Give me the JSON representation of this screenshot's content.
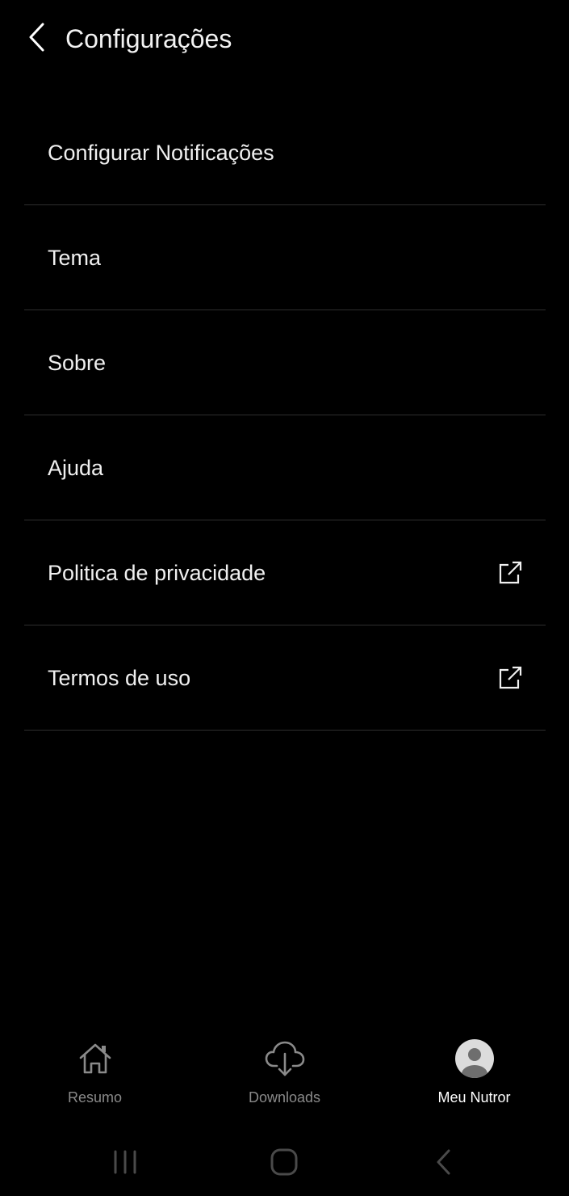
{
  "header": {
    "back_icon": "chevron-left-icon",
    "title": "Configurações"
  },
  "menu": {
    "items": [
      {
        "label": "Configurar Notificações",
        "external": false
      },
      {
        "label": "Tema",
        "external": false
      },
      {
        "label": "Sobre",
        "external": false
      },
      {
        "label": "Ajuda",
        "external": false
      },
      {
        "label": "Politica de privacidade",
        "external": true,
        "icon": "external-link-icon"
      },
      {
        "label": "Termos de uso",
        "external": true,
        "icon": "external-link-icon"
      }
    ]
  },
  "bottom_nav": {
    "items": [
      {
        "label": "Resumo",
        "icon": "home-icon",
        "active": false
      },
      {
        "label": "Downloads",
        "icon": "cloud-download-icon",
        "active": false
      },
      {
        "label": "Meu Nutror",
        "icon": "avatar-icon",
        "active": true
      }
    ]
  },
  "system_nav": {
    "recents_icon": "recents-icon",
    "home_icon": "home-button-icon",
    "back_icon": "system-back-icon"
  },
  "colors": {
    "background": "#000000",
    "text_primary": "#f0f0f0",
    "text_inactive": "#8a8a8a",
    "divider": "#2e2e2e"
  }
}
